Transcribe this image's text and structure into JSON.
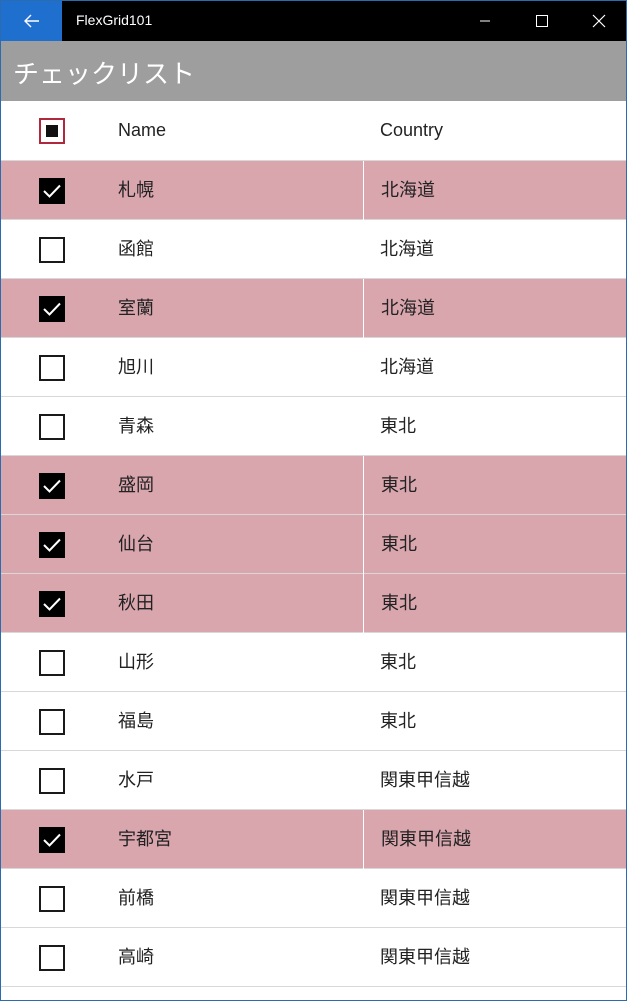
{
  "window": {
    "title": "FlexGrid101",
    "back_icon": "arrow-left-icon",
    "minimize_icon": "minimize-icon",
    "maximize_icon": "maximize-icon",
    "close_icon": "close-icon"
  },
  "header": {
    "title": "チェックリスト"
  },
  "grid": {
    "columns": {
      "select_state": "indeterminate",
      "name": "Name",
      "country": "Country"
    },
    "rows": [
      {
        "name": "札幌",
        "country": "北海道",
        "checked": true
      },
      {
        "name": "函館",
        "country": "北海道",
        "checked": false
      },
      {
        "name": "室蘭",
        "country": "北海道",
        "checked": true
      },
      {
        "name": "旭川",
        "country": "北海道",
        "checked": false
      },
      {
        "name": "青森",
        "country": "東北",
        "checked": false
      },
      {
        "name": "盛岡",
        "country": "東北",
        "checked": true
      },
      {
        "name": "仙台",
        "country": "東北",
        "checked": true
      },
      {
        "name": "秋田",
        "country": "東北",
        "checked": true
      },
      {
        "name": "山形",
        "country": "東北",
        "checked": false
      },
      {
        "name": "福島",
        "country": "東北",
        "checked": false
      },
      {
        "name": "水戸",
        "country": "関東甲信越",
        "checked": false
      },
      {
        "name": "宇都宮",
        "country": "関東甲信越",
        "checked": true
      },
      {
        "name": "前橋",
        "country": "関東甲信越",
        "checked": false
      },
      {
        "name": "高崎",
        "country": "関東甲信越",
        "checked": false
      }
    ]
  },
  "colors": {
    "selected_row": "#d9a6ae",
    "accent": "#1f6fcf",
    "header_bg": "#9e9e9e"
  }
}
